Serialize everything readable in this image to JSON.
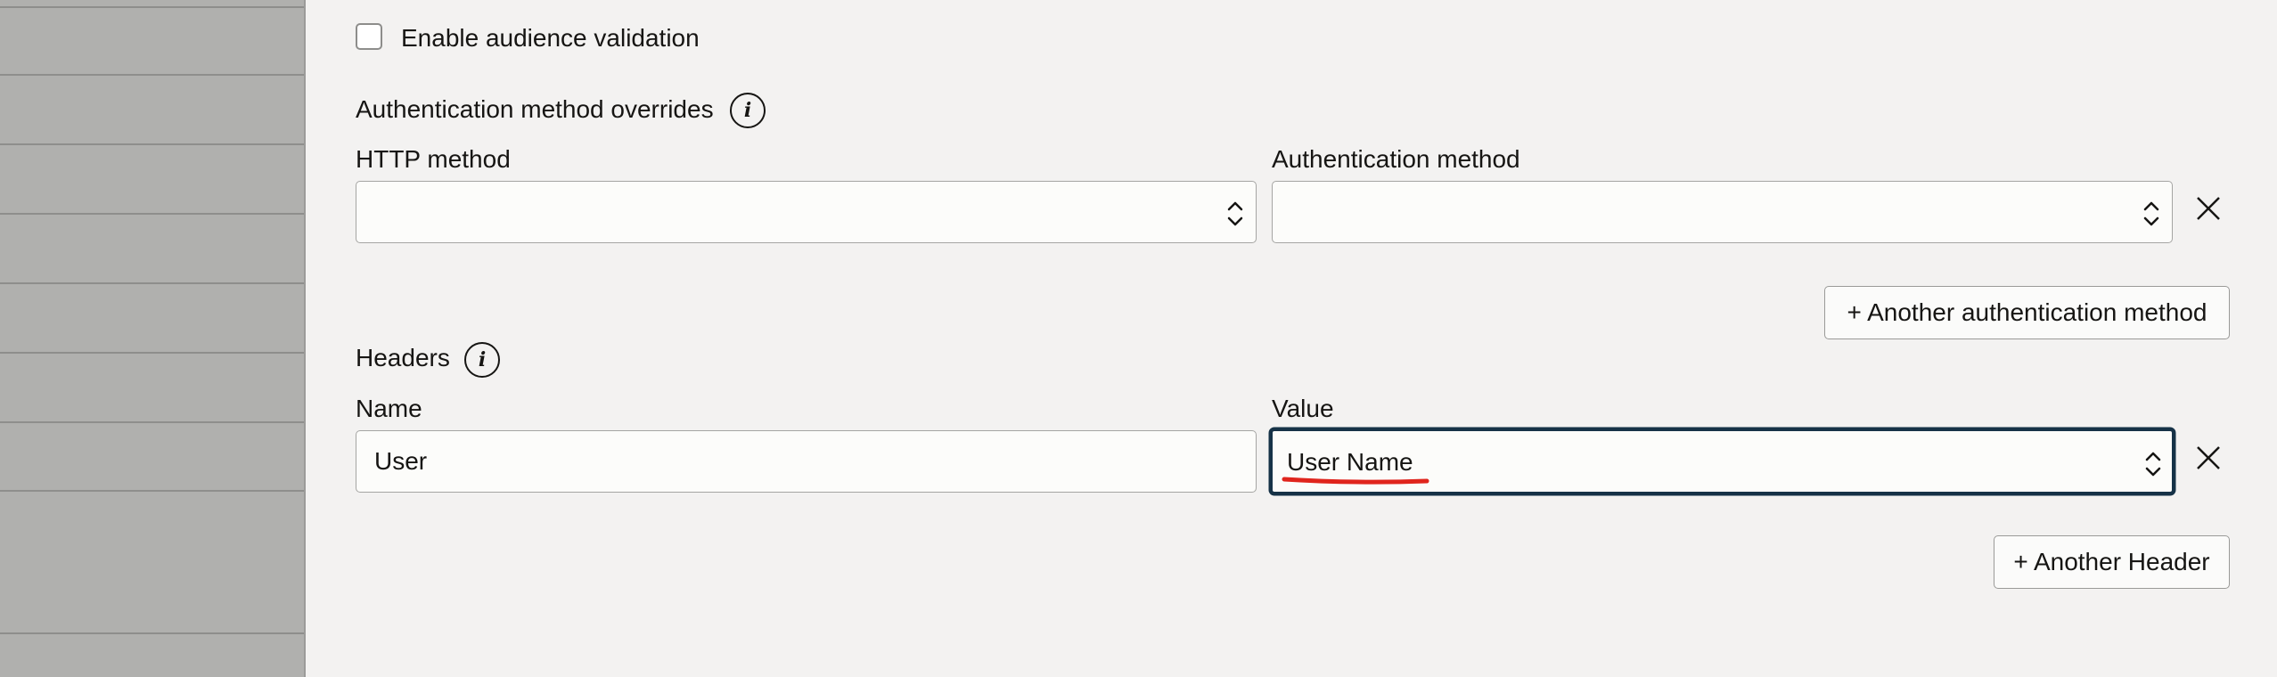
{
  "audience_validation": {
    "label": "Enable audience validation",
    "checked": false
  },
  "auth_overrides": {
    "title": "Authentication method overrides",
    "info_icon": "info-icon",
    "http_method": {
      "label": "HTTP method",
      "value": ""
    },
    "auth_method": {
      "label": "Authentication method",
      "value": ""
    },
    "add_button": "+ Another authentication method"
  },
  "headers": {
    "title": "Headers",
    "info_icon": "info-icon",
    "name": {
      "label": "Name",
      "value": "User"
    },
    "value": {
      "label": "Value",
      "value": "User Name"
    },
    "add_button": "+ Another Header"
  },
  "colors": {
    "focus_border": "#163247",
    "annotation": "#e0251d",
    "sidebar": "#b0b0ae",
    "background": "#f3f2f1"
  }
}
